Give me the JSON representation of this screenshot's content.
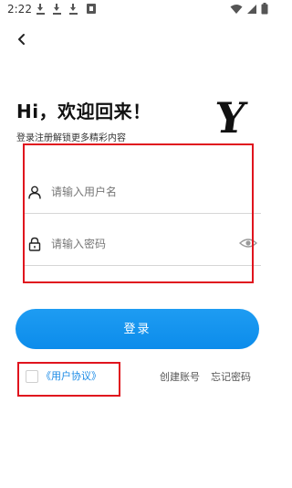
{
  "status_bar": {
    "time": "2:22",
    "icons": [
      "download-icon",
      "download-icon",
      "download-icon",
      "app-notification-icon",
      "wifi-icon",
      "signal-icon",
      "battery-icon"
    ]
  },
  "nav": {
    "back_icon": "chevron-left-icon"
  },
  "header": {
    "greeting": "Hi，欢迎回来！",
    "subtitle": "登录注册解锁更多精彩内容",
    "logo_text": "Y"
  },
  "form": {
    "username": {
      "placeholder": "请输入用户名",
      "value": "",
      "icon": "user-icon"
    },
    "password": {
      "placeholder": "请输入密码",
      "value": "",
      "icon": "lock-icon",
      "toggle_icon": "eye-icon"
    },
    "login_label": "登录"
  },
  "footer": {
    "agreement_checked": false,
    "agreement_label": "《用户协议》",
    "register_label": "创建账号",
    "forgot_label": "忘记密码"
  },
  "colors": {
    "primary": "#0c8ceb",
    "highlight": "#e0141e",
    "link": "#1a8ae6"
  }
}
